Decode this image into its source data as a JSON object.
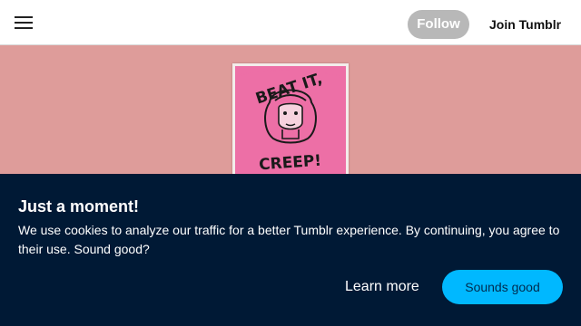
{
  "header": {
    "menu_icon": "hamburger-menu-icon",
    "follow_label": "Follow",
    "join_label": "Join Tumblr"
  },
  "banner": {
    "poster_image": "pink poster with illustrated woman's face",
    "poster_text_top": "BEAT IT,",
    "poster_text_bottom": "CREEP!"
  },
  "cookie_notice": {
    "title": "Just a moment!",
    "message": "We use cookies to analyze our traffic for a better Tumblr experience. By continuing, you agree to their use. Sound good?",
    "learn_more_label": "Learn more",
    "accept_label": "Sounds good"
  },
  "colors": {
    "banner_bg": "#de9c9a",
    "poster_pink": "#ed6fa6",
    "cookie_bg": "#001935",
    "accept_button": "#00b8ff",
    "follow_button": "#b8b8b8"
  }
}
